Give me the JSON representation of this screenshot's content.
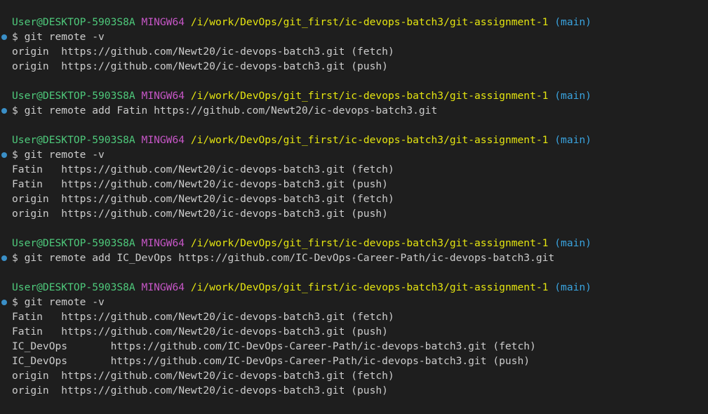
{
  "colors": {
    "background": "#1e1e1e",
    "user_host": "#4ec97b",
    "msystem": "#c656c6",
    "path": "#e5e510",
    "branch": "#3aa4e0",
    "text": "#cccccc",
    "success_decoration": "#3a8fc7"
  },
  "prompt": {
    "user_host": "User@DESKTOP-5903S8A",
    "msystem": "MINGW64",
    "path": "/i/work/DevOps/git_first/ic-devops-batch3/git-assignment-1",
    "branch": "(main)"
  },
  "blocks": [
    {
      "command": "$ git remote -v",
      "output": [
        "origin  https://github.com/Newt20/ic-devops-batch3.git (fetch)",
        "origin  https://github.com/Newt20/ic-devops-batch3.git (push)"
      ]
    },
    {
      "command": "$ git remote add Fatin https://github.com/Newt20/ic-devops-batch3.git",
      "output": []
    },
    {
      "command": "$ git remote -v",
      "output": [
        "Fatin   https://github.com/Newt20/ic-devops-batch3.git (fetch)",
        "Fatin   https://github.com/Newt20/ic-devops-batch3.git (push)",
        "origin  https://github.com/Newt20/ic-devops-batch3.git (fetch)",
        "origin  https://github.com/Newt20/ic-devops-batch3.git (push)"
      ]
    },
    {
      "command": "$ git remote add IC_DevOps https://github.com/IC-DevOps-Career-Path/ic-devops-batch3.git",
      "output": []
    },
    {
      "command": "$ git remote -v",
      "output": [
        "Fatin   https://github.com/Newt20/ic-devops-batch3.git (fetch)",
        "Fatin   https://github.com/Newt20/ic-devops-batch3.git (push)",
        "IC_DevOps       https://github.com/IC-DevOps-Career-Path/ic-devops-batch3.git (fetch)",
        "IC_DevOps       https://github.com/IC-DevOps-Career-Path/ic-devops-batch3.git (push)",
        "origin  https://github.com/Newt20/ic-devops-batch3.git (fetch)",
        "origin  https://github.com/Newt20/ic-devops-batch3.git (push)"
      ]
    }
  ]
}
